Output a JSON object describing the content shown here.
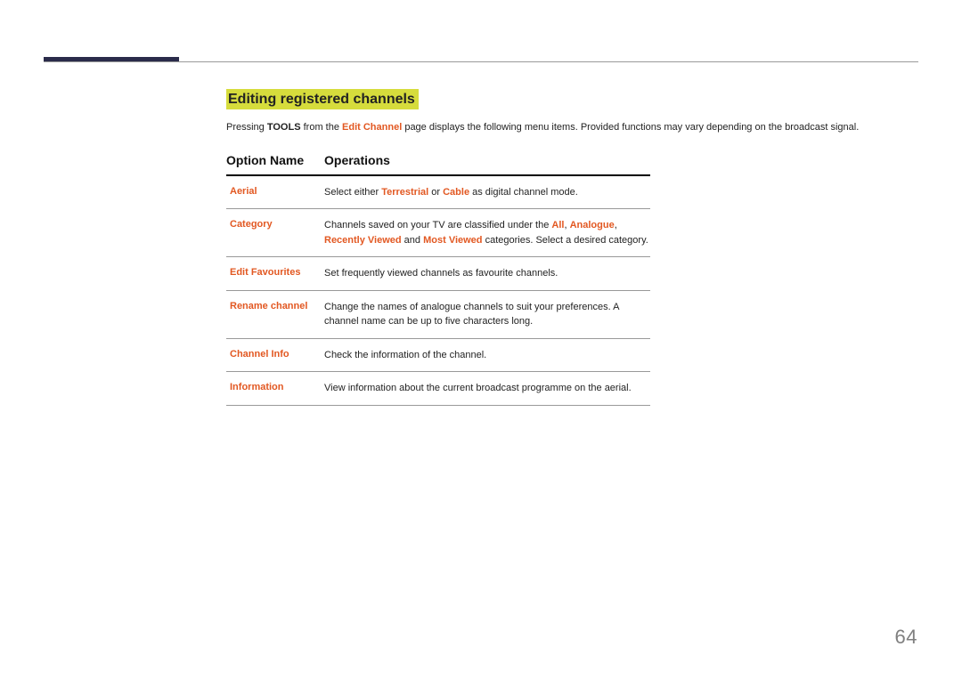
{
  "section_title": "Editing registered channels",
  "intro": {
    "prefix": "Pressing ",
    "bold": "TOOLS",
    "mid1": " from the ",
    "link": "Edit Channel",
    "suffix": " page displays the following menu items. Provided functions may vary depending on the broadcast signal."
  },
  "table": {
    "head": {
      "col1": "Option Name",
      "col2": "Operations"
    },
    "rows": [
      {
        "option": "Aerial",
        "desc_parts": [
          {
            "t": "text",
            "v": "Select either "
          },
          {
            "t": "hl",
            "v": "Terrestrial"
          },
          {
            "t": "text",
            "v": " or "
          },
          {
            "t": "hl",
            "v": "Cable"
          },
          {
            "t": "text",
            "v": " as digital channel mode."
          }
        ]
      },
      {
        "option": "Category",
        "desc_parts": [
          {
            "t": "text",
            "v": "Channels saved on your TV are classified under the "
          },
          {
            "t": "hl",
            "v": "All"
          },
          {
            "t": "text",
            "v": ", "
          },
          {
            "t": "hl",
            "v": "Analogue"
          },
          {
            "t": "text",
            "v": ", "
          },
          {
            "t": "hl",
            "v": "Recently Viewed"
          },
          {
            "t": "text",
            "v": " and "
          },
          {
            "t": "hl",
            "v": "Most Viewed"
          },
          {
            "t": "text",
            "v": " categories. Select a desired category."
          }
        ]
      },
      {
        "option": "Edit Favourites",
        "desc_parts": [
          {
            "t": "text",
            "v": "Set frequently viewed channels as favourite channels."
          }
        ]
      },
      {
        "option": "Rename channel",
        "desc_parts": [
          {
            "t": "text",
            "v": "Change the names of analogue channels to suit your preferences. A channel name can be up to five characters long."
          }
        ]
      },
      {
        "option": "Channel Info",
        "desc_parts": [
          {
            "t": "text",
            "v": "Check the information of the channel."
          }
        ]
      },
      {
        "option": "Information",
        "desc_parts": [
          {
            "t": "text",
            "v": "View information about the current broadcast programme on the aerial."
          }
        ]
      }
    ]
  },
  "page_number": "64"
}
